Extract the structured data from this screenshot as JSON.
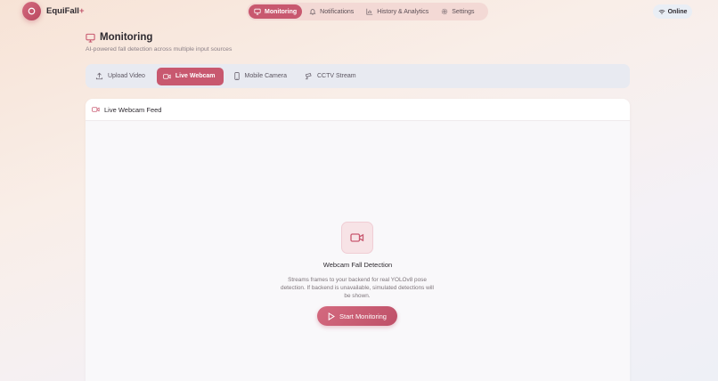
{
  "brand": {
    "name": "EquiFall",
    "suffix": "+"
  },
  "nav": {
    "items": [
      {
        "label": "Monitoring",
        "icon": "monitor-icon",
        "active": true
      },
      {
        "label": "Notifications",
        "icon": "bell-icon",
        "active": false
      },
      {
        "label": "History & Analytics",
        "icon": "chart-icon",
        "active": false
      },
      {
        "label": "Settings",
        "icon": "gear-icon",
        "active": false
      }
    ]
  },
  "status": {
    "label": "Online",
    "icon": "wifi-icon"
  },
  "page": {
    "title": "Monitoring",
    "subtitle": "AI-powered fall detection across multiple input sources"
  },
  "tabs": [
    {
      "label": "Upload Video",
      "icon": "upload-icon",
      "active": false
    },
    {
      "label": "Live Webcam",
      "icon": "video-icon",
      "active": true
    },
    {
      "label": "Mobile Camera",
      "icon": "phone-icon",
      "active": false
    },
    {
      "label": "CCTV Stream",
      "icon": "cctv-icon",
      "active": false
    }
  ],
  "feed": {
    "title": "Live Webcam Feed",
    "detection_title": "Webcam Fall Detection",
    "description": "Streams frames to your backend for real YOLOv8 pose detection. If backend is unavailable, simulated detections will be shown.",
    "start_label": "Start Monitoring"
  },
  "colors": {
    "accent": "#c8586f",
    "accent_soft": "#f7e3e6",
    "nav_bg": "#f3d9d5",
    "tabs_bg": "#e8eaf1"
  }
}
